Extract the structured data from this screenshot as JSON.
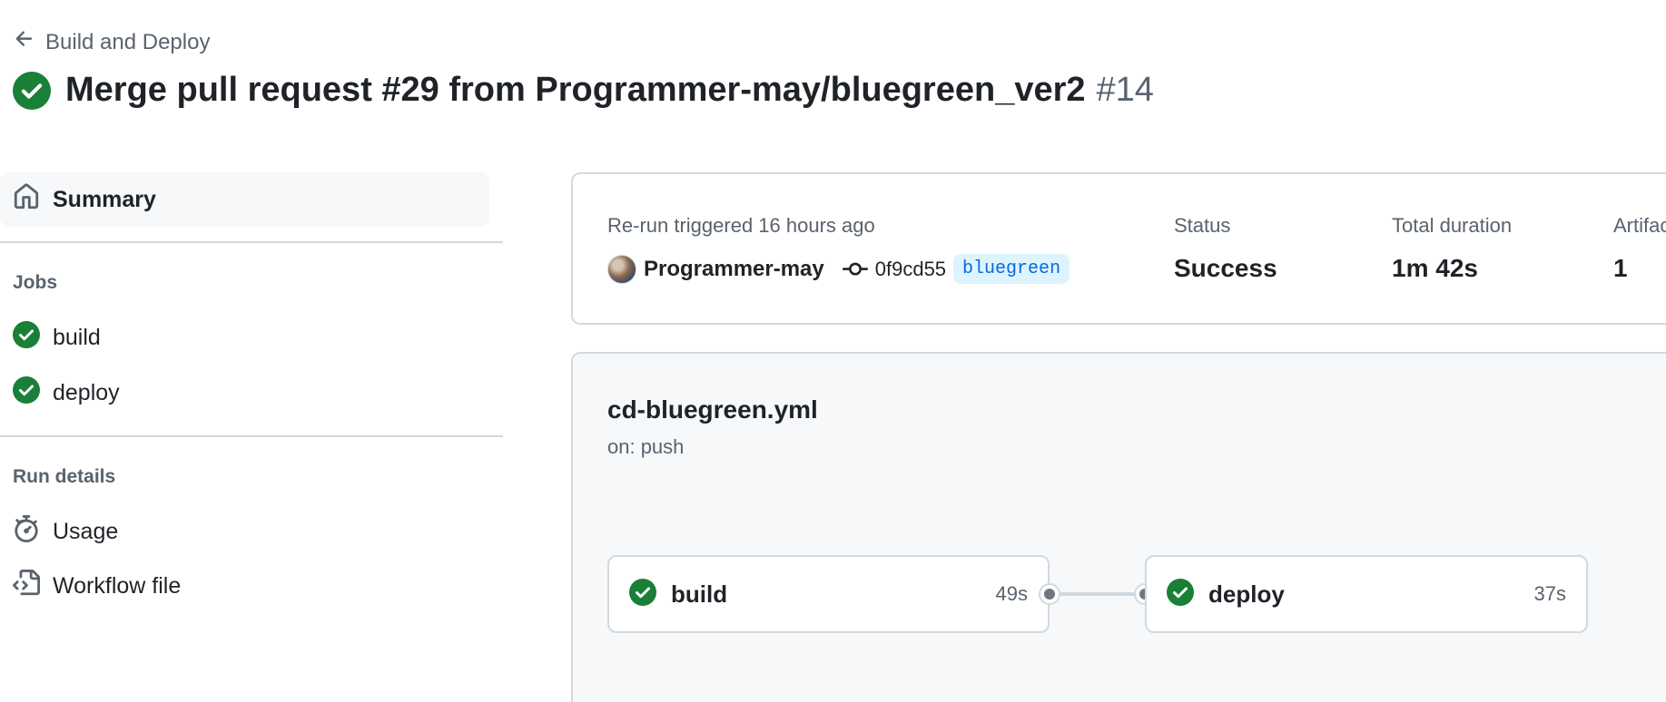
{
  "header": {
    "back_label": "Build and Deploy",
    "title": "Merge pull request #29 from Programmer-may/bluegreen_ver2",
    "run_number": "#14"
  },
  "sidebar": {
    "summary_label": "Summary",
    "jobs_heading": "Jobs",
    "jobs": [
      {
        "label": "build",
        "status": "success"
      },
      {
        "label": "deploy",
        "status": "success"
      }
    ],
    "run_details_heading": "Run details",
    "details": [
      {
        "label": "Usage",
        "icon": "stopwatch-icon"
      },
      {
        "label": "Workflow file",
        "icon": "file-code-icon"
      }
    ]
  },
  "summary": {
    "trigger_text": "Re-run triggered 16 hours ago",
    "actor": "Programmer-may",
    "commit_sha": "0f9cd55",
    "branch": "bluegreen",
    "status_label": "Status",
    "status_value": "Success",
    "duration_label": "Total duration",
    "duration_value": "1m 42s",
    "artifacts_label": "Artifacts",
    "artifacts_value": "1"
  },
  "workflow": {
    "file_name": "cd-bluegreen.yml",
    "trigger": "on: push",
    "jobs": [
      {
        "name": "build",
        "duration": "49s",
        "status": "success"
      },
      {
        "name": "deploy",
        "duration": "37s",
        "status": "success"
      }
    ]
  },
  "colors": {
    "success": "#1a7f37",
    "accent": "#0969da",
    "muted_text": "#59636e",
    "border": "#d1d9e0",
    "subtle_bg": "#f6f8fa"
  }
}
